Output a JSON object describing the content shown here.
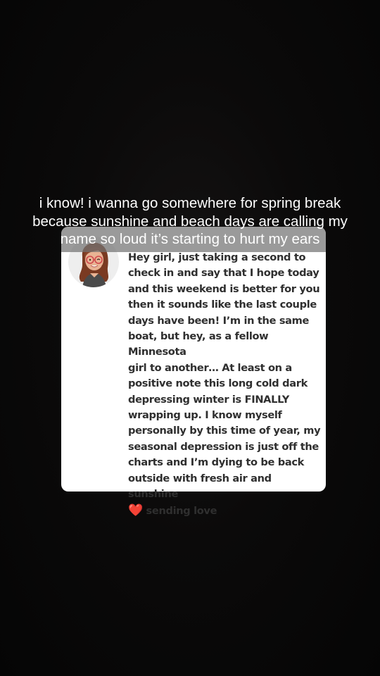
{
  "caption": {
    "text": "i know! i wanna go somewhere for spring break\nbecause sunshine and beach days are calling my\nname so loud it’s starting to hurt my ears"
  },
  "reply_card": {
    "username": "",
    "message": "Hey girl, just taking a second to\ncheck in and say that I hope today\nand this weekend is better for you\nthen it sounds like the last couple\ndays have been! I’m in the same\nboat, but hey, as a fellow Minnesota\ngirl to another… At least on a\npositive note this long cold dark\ndepressing winter is FINALLY\nwrapping up. I know myself\npersonally by this time of year, my\nseasonal depression is just off the\ncharts and I’m dying to be back\noutside with fresh air and sunshine",
    "closing_emoji": "❤️",
    "closing_text": " sending love",
    "avatar": "bitmoji-woman-glasses-red-hair",
    "accent_color": "#3b8fd0"
  },
  "colors": {
    "background": "#080707",
    "card": "#ffffff",
    "caption_band": "#737373",
    "heart": "#e0232e"
  }
}
